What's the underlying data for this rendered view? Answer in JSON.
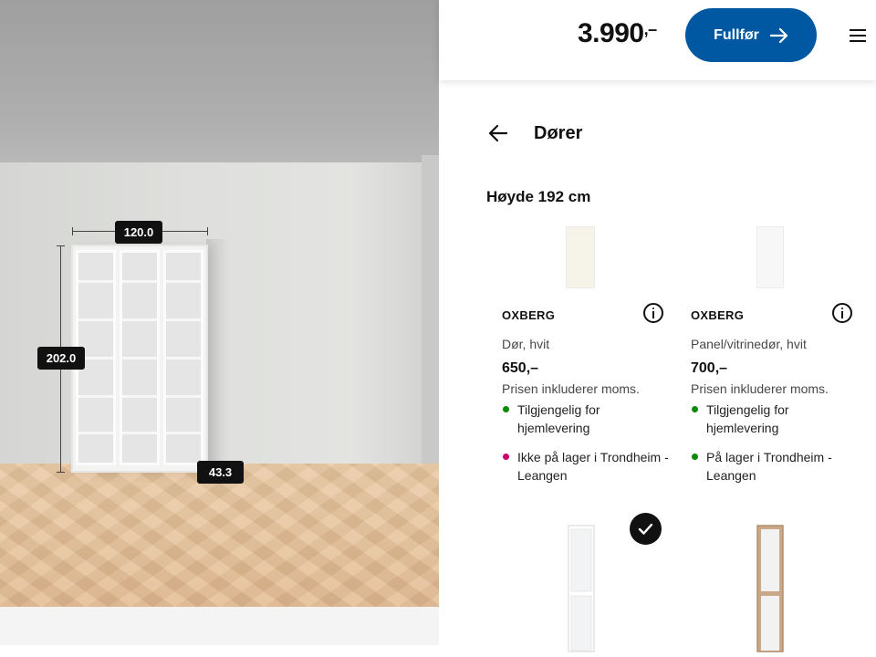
{
  "header": {
    "total_price": "3.990",
    "total_price_suffix": ",–",
    "finish_label": "Fullfør",
    "finish_icon": "arrow-right-icon",
    "menu_icon": "hamburger-menu-icon",
    "accent_color": "#0058a3"
  },
  "viewport": {
    "width_label": "120.0",
    "height_label": "202.0",
    "depth_label": "43.3"
  },
  "section": {
    "back_icon": "arrow-left-icon",
    "title": "Dører",
    "subheading": "Høyde 192 cm"
  },
  "products": [
    {
      "name": "OXBERG",
      "description": "Dør, hvit",
      "price": "650,–",
      "vat_note": "Prisen inkluderer moms.",
      "availability": [
        {
          "status": "available",
          "color": "#0a8a00",
          "text": "Tilgjengelig for hjemlevering"
        },
        {
          "status": "unavailable",
          "color": "#cc0066",
          "text": "Ikke på lager i Trondheim - Leangen"
        }
      ]
    },
    {
      "name": "OXBERG",
      "description": "Panel/vitrinedør, hvit",
      "price": "700,–",
      "vat_note": "Prisen inkluderer moms.",
      "availability": [
        {
          "status": "available",
          "color": "#0a8a00",
          "text": "Tilgjengelig for hjemlevering"
        },
        {
          "status": "available",
          "color": "#0a8a00",
          "text": "På lager i Trondheim - Leangen"
        }
      ]
    }
  ],
  "selected_icon": "checkmark-icon"
}
